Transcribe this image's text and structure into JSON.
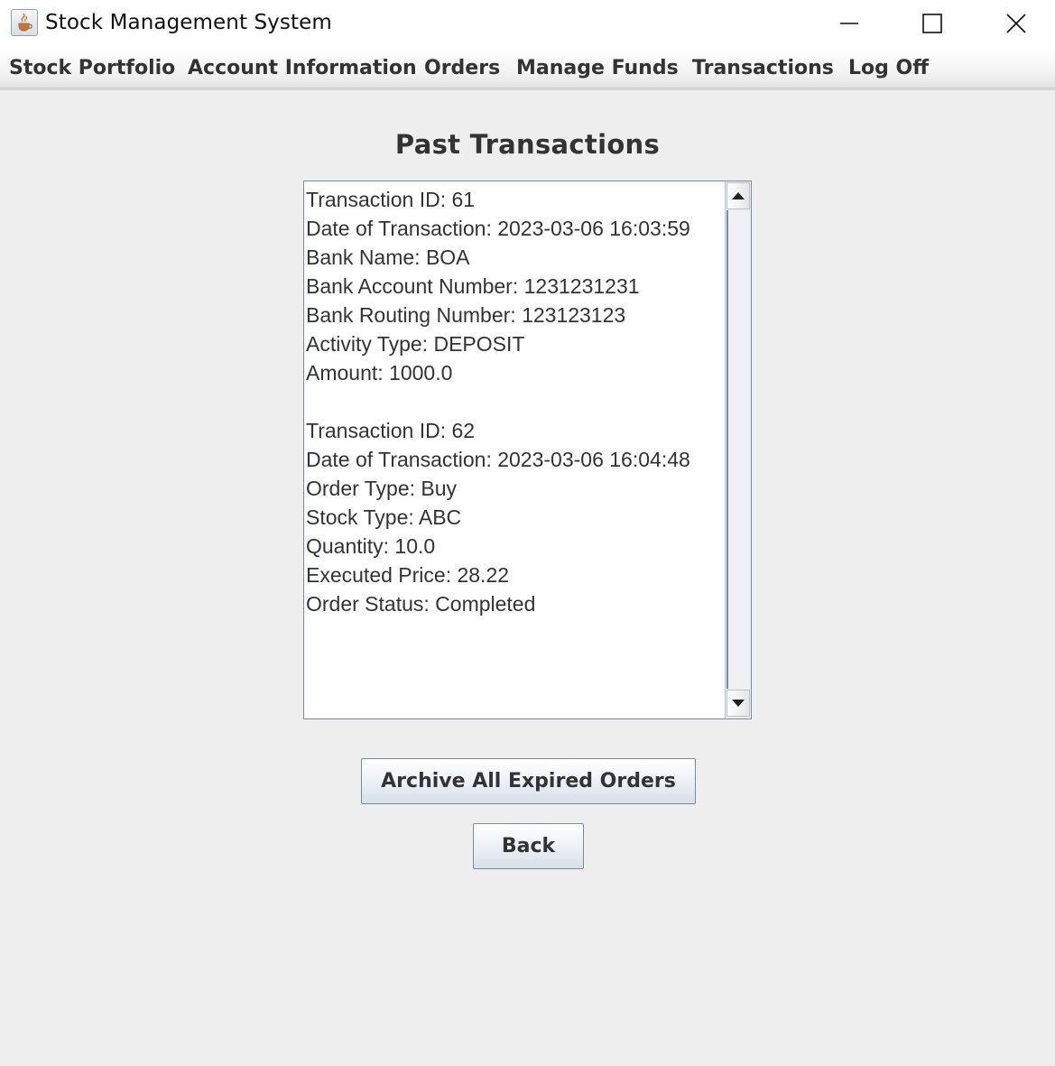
{
  "window": {
    "title": "Stock Management System",
    "app_icon": "java-coffee-icon",
    "controls": [
      "minimize-icon",
      "maximize-icon",
      "close-icon"
    ]
  },
  "menu": {
    "items": [
      {
        "label": "Stock Portfolio"
      },
      {
        "label": "Account Information"
      },
      {
        "label": "Orders"
      },
      {
        "label": "Manage Funds"
      },
      {
        "label": "Transactions"
      },
      {
        "label": "Log Off"
      }
    ]
  },
  "main": {
    "heading": "Past Transactions",
    "transactions_text": [
      "Transaction ID: 61",
      "Date of Transaction: 2023-03-06 16:03:59",
      "Bank Name: BOA",
      "Bank Account Number: 1231231231",
      "Bank Routing Number: 123123123",
      "Activity Type: DEPOSIT",
      "Amount: 1000.0",
      "",
      "Transaction ID: 62",
      "Date of Transaction: 2023-03-06 16:04:48",
      "Order Type: Buy",
      "Stock Type: ABC",
      "Quantity: 10.0",
      "Executed Price: 28.22",
      "Order Status: Completed"
    ],
    "archive_button": "Archive All Expired Orders",
    "back_button": "Back"
  },
  "colors": {
    "background": "#eeeeee",
    "text": "#333333",
    "button_gradient_bottom": "#d5e0ea",
    "border": "#7a8a99"
  }
}
